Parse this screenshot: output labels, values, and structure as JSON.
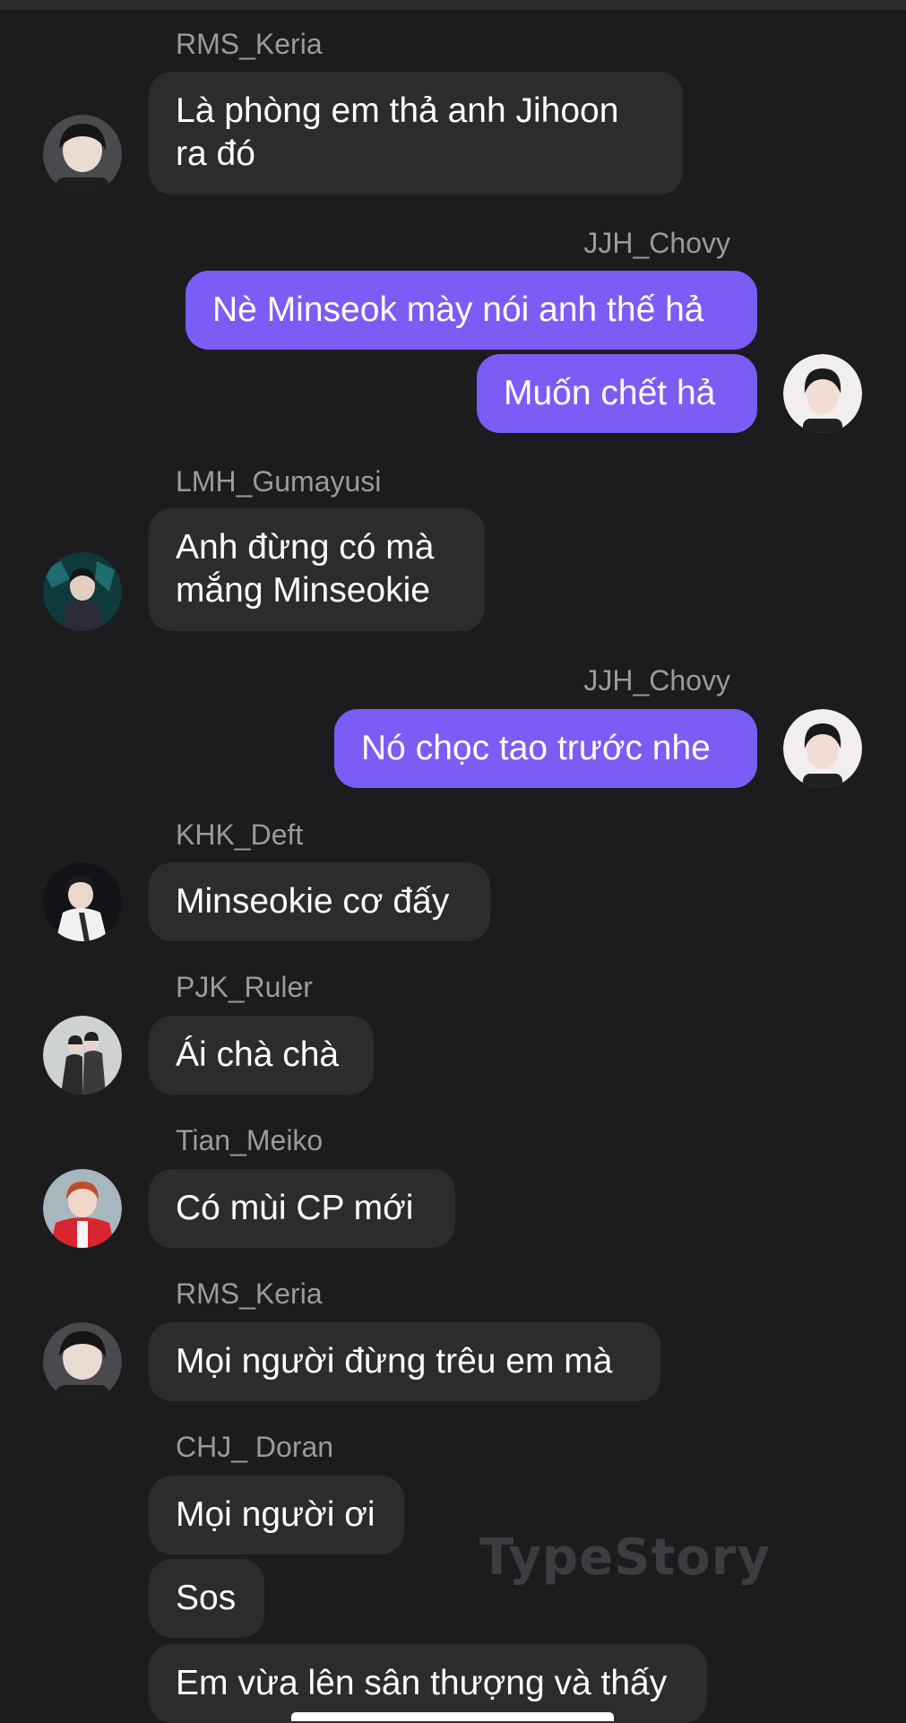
{
  "messages": [
    {
      "sender": "RMS_Keria",
      "lines": [
        "Là phòng em thả anh Jihoon",
        "ra đó"
      ]
    },
    {
      "sender": "JJH_Chovy",
      "lines": [
        "Nè Minseok mày nói anh thế hả"
      ]
    },
    {
      "lines": [
        "Muốn chết hả"
      ]
    },
    {
      "sender": "LMH_Gumayusi",
      "lines": [
        "Anh đừng có mà",
        "mắng Minseokie"
      ]
    },
    {
      "sender": "JJH_Chovy",
      "lines": [
        "Nó chọc tao trước nhe"
      ]
    },
    {
      "sender": "KHK_Deft",
      "lines": [
        "Minseokie cơ đấy"
      ]
    },
    {
      "sender": "PJK_Ruler",
      "lines": [
        "Ái chà chà"
      ]
    },
    {
      "sender": "Tian_Meiko",
      "lines": [
        "Có mùi CP mới"
      ]
    },
    {
      "sender": "RMS_Keria",
      "lines": [
        "Mọi người đừng trêu em mà"
      ]
    },
    {
      "sender": "CHJ_ Doran",
      "lines": [
        "Mọi người ơi"
      ]
    },
    {
      "lines": [
        "Sos"
      ]
    },
    {
      "lines": [
        "Em vừa lên sân thượng và thấy"
      ]
    }
  ],
  "watermark": "TypeStory",
  "colors": {
    "background": "#1c1c1e",
    "incoming_bubble": "#2c2c2e",
    "outgoing_bubble": "#7b5cf5",
    "sender_name": "#9a9a9f"
  }
}
